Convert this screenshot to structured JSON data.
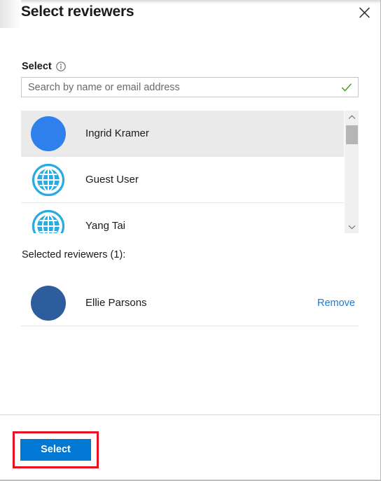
{
  "dialog": {
    "title": "Select reviewers",
    "close_icon": "close-icon"
  },
  "form": {
    "label": "Select",
    "info_icon": "info-icon",
    "search": {
      "value": "",
      "placeholder": "Search by name or email address",
      "valid_icon": "checkmark-icon"
    }
  },
  "results": {
    "rows": [
      {
        "name": "Ingrid Kramer",
        "avatar": "person-avatar",
        "avatar_style": "solid-bright",
        "selected": true
      },
      {
        "name": "Guest User",
        "avatar": "globe-icon",
        "avatar_style": "globe",
        "selected": false
      },
      {
        "name": "Yang Tai",
        "avatar": "globe-icon",
        "avatar_style": "globe",
        "selected": false
      }
    ],
    "scrollbar": {
      "up_icon": "chevron-up-icon",
      "down_icon": "chevron-down-icon"
    }
  },
  "selected_section": {
    "heading": "Selected reviewers (1):",
    "rows": [
      {
        "name": "Ellie Parsons",
        "avatar": "person-avatar",
        "avatar_style": "solid-dark",
        "remove_label": "Remove"
      }
    ]
  },
  "footer": {
    "select_label": "Select"
  },
  "colors": {
    "accent": "#0078d4",
    "link": "#1f7ad4",
    "highlight": "#e81123",
    "avatar_bright": "#2f80ed",
    "avatar_dark": "#2e5d9e",
    "globe": "#29abe2",
    "valid_check": "#4f9c20"
  }
}
